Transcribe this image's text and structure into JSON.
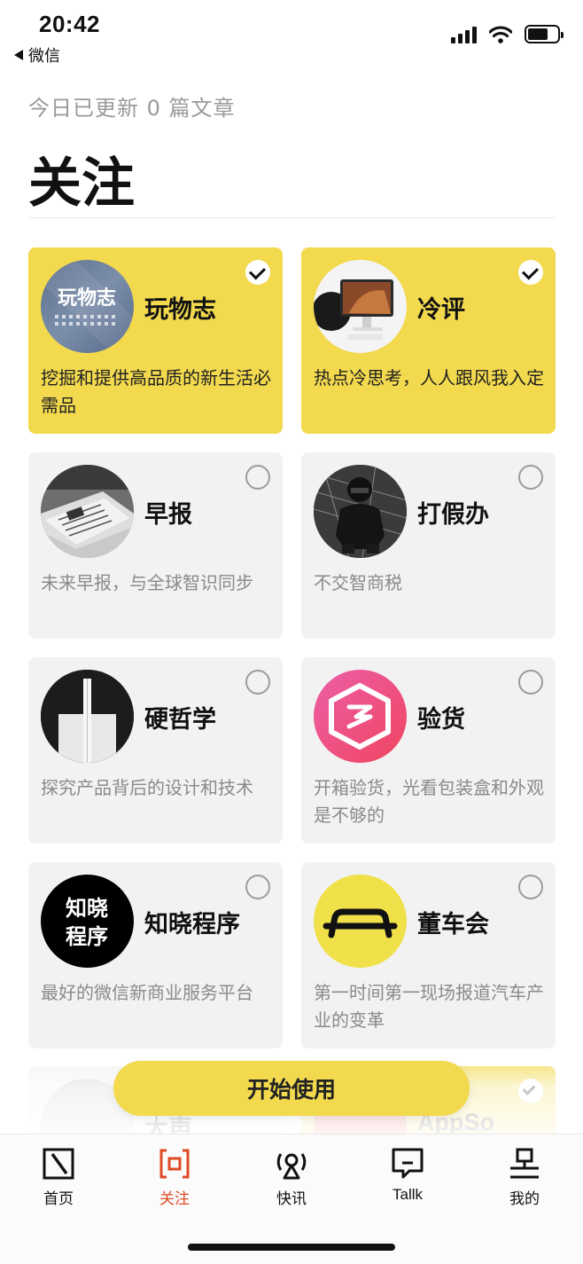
{
  "status_bar": {
    "time": "20:42",
    "back_app": "微信"
  },
  "header": {
    "update_text": "今日已更新 0 篇文章",
    "title": "关注"
  },
  "cards": [
    {
      "name": "玩物志",
      "desc": "挖掘和提供高品质的新生活必需品",
      "selected": true,
      "avatar_text": "玩物志",
      "icon": "wanwuzhi-logo"
    },
    {
      "name": "冷评",
      "desc": "热点冷思考，人人跟风我入定",
      "selected": true,
      "icon": "computer-desk-photo"
    },
    {
      "name": "早报",
      "desc": "未来早报，与全球智识同步",
      "selected": false,
      "icon": "newspaper-photo"
    },
    {
      "name": "打假办",
      "desc": "不交智商税",
      "selected": false,
      "icon": "motorcycle-rider-photo"
    },
    {
      "name": "硬哲学",
      "desc": "探究产品背后的设计和技术",
      "selected": false,
      "icon": "product-detail-photo"
    },
    {
      "name": "验货",
      "desc": "开箱验货，光看包装盒和外观是不够的",
      "selected": false,
      "icon": "hexagon-box-logo"
    },
    {
      "name": "知晓程序",
      "desc": "最好的微信新商业服务平台",
      "selected": false,
      "avatar_text_line1": "知晓",
      "avatar_text_line2": "程序",
      "icon": "zhixiao-logo"
    },
    {
      "name": "董车会",
      "desc": "第一时间第一现场报道汽车产业的变革",
      "selected": false,
      "icon": "car-outline-logo"
    }
  ],
  "partial_cards": [
    {
      "name": "大声",
      "selected": false
    },
    {
      "name": "AppSo",
      "selected": true
    }
  ],
  "start_button": "开始使用",
  "tabs": [
    {
      "label": "首页",
      "icon": "home-slash-icon",
      "active": false
    },
    {
      "label": "关注",
      "icon": "follow-bracket-icon",
      "active": true
    },
    {
      "label": "快讯",
      "icon": "radio-tower-icon",
      "active": false
    },
    {
      "label": "Tallk",
      "icon": "chat-bubble-icon",
      "active": false
    },
    {
      "label": "我的",
      "icon": "profile-icon",
      "active": false
    }
  ],
  "colors": {
    "accent_yellow": "#f2d94e",
    "active_tab": "#e04a24",
    "muted_text": "#9a9a9a"
  }
}
